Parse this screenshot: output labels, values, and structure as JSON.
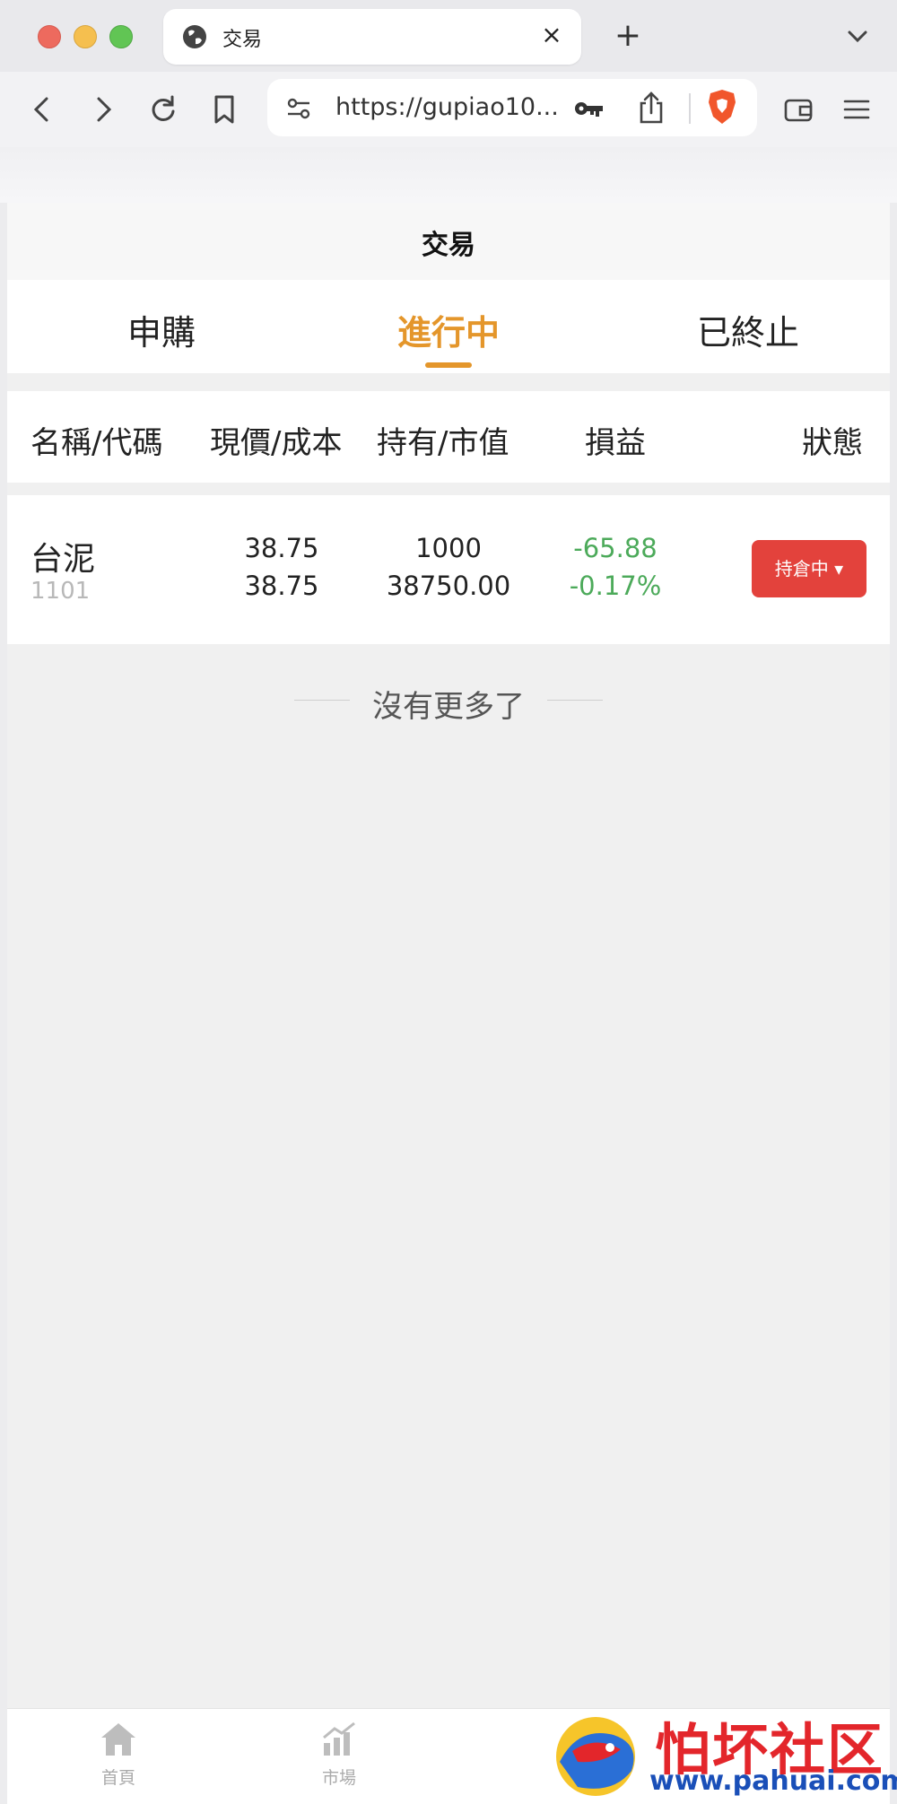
{
  "browser": {
    "tab_title": "交易",
    "tab_close_glyph": "×",
    "new_tab_glyph": "+",
    "url": "https://gupiao10...",
    "icons": [
      "globe-icon",
      "back-icon",
      "forward-icon",
      "reload-icon",
      "bookmark-icon",
      "tune-icon",
      "key-icon",
      "share-icon",
      "brave-shield-icon",
      "wallet-icon",
      "menu-icon",
      "chevron-down-icon"
    ]
  },
  "header": {
    "title": "交易"
  },
  "tabs": [
    {
      "label": "申購",
      "active": false
    },
    {
      "label": "進行中",
      "active": true
    },
    {
      "label": "已終止",
      "active": false
    }
  ],
  "columns": [
    "名稱/代碼",
    "現價/成本",
    "持有/市值",
    "損益",
    "狀態"
  ],
  "rows": [
    {
      "name": "台泥",
      "code": "1101",
      "price": "38.75",
      "cost": "38.75",
      "shares": "1000",
      "market_value": "38750.00",
      "pnl": "-65.88",
      "pnl_pct": "-0.17%",
      "status": "持倉中 ▾"
    }
  ],
  "list_end": "沒有更多了",
  "bottom_nav": [
    {
      "label": "首頁",
      "icon": "home-icon"
    },
    {
      "label": "市場",
      "icon": "market-chart-icon"
    }
  ],
  "watermark": {
    "text": "怕坏社区",
    "url": "www.pahuai.com"
  },
  "colors": {
    "accent": "#e4962b",
    "status_red": "#e3423c",
    "loss_green": "#4caa5a"
  }
}
